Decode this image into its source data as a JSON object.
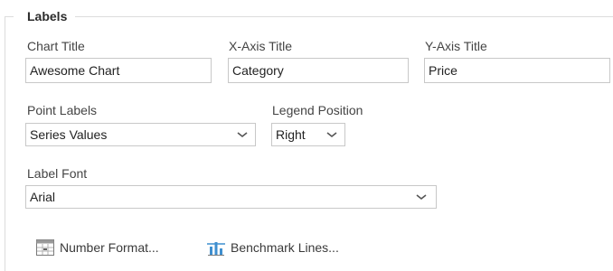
{
  "section": {
    "legend": "Labels"
  },
  "fields": {
    "chart_title": {
      "label": "Chart Title",
      "value": "Awesome Chart"
    },
    "x_axis_title": {
      "label": "X-Axis Title",
      "value": "Category"
    },
    "y_axis_title": {
      "label": "Y-Axis Title",
      "value": "Price"
    },
    "point_labels": {
      "label": "Point Labels",
      "value": "Series Values"
    },
    "legend_position": {
      "label": "Legend Position",
      "value": "Right"
    },
    "label_font": {
      "label": "Label Font",
      "value": "Arial"
    }
  },
  "toolbar": {
    "number_format_label": "Number Format...",
    "benchmark_lines_label": "Benchmark Lines..."
  },
  "icons": {
    "chevron": "chevron-down-icon",
    "number_format": "number-format-icon",
    "benchmark_lines": "benchmark-lines-icon"
  },
  "colors": {
    "border": "#c8c8c8",
    "divider": "#dcdcdc",
    "text": "#444444",
    "icon_blue": "#3f8fcf"
  }
}
